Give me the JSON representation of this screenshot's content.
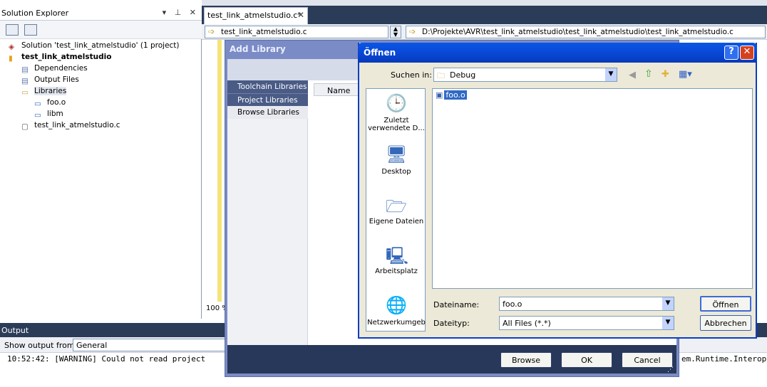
{
  "solution_explorer": {
    "title": "Solution Explorer",
    "controls": "▾ ⊥ ✕",
    "tree": [
      {
        "label": "Solution 'test_link_atmelstudio' (1 project)",
        "level": 0,
        "bold": false,
        "icon": "solution-icon"
      },
      {
        "label": "test_link_atmelstudio",
        "level": 0,
        "bold": true,
        "icon": "project-icon"
      },
      {
        "label": "Dependencies",
        "level": 1,
        "bold": false,
        "icon": "folder-icon"
      },
      {
        "label": "Output Files",
        "level": 1,
        "bold": false,
        "icon": "folder-icon"
      },
      {
        "label": "Libraries",
        "level": 1,
        "bold": false,
        "icon": "folder-open-icon"
      },
      {
        "label": "foo.o",
        "level": 2,
        "bold": false,
        "icon": "reference-icon"
      },
      {
        "label": "libm",
        "level": 2,
        "bold": false,
        "icon": "reference-icon"
      },
      {
        "label": "test_link_atmelstudio.c",
        "level": 1,
        "bold": false,
        "icon": "c-file-icon"
      }
    ]
  },
  "editor": {
    "tab_label": "test_link_atmelstudio.c*",
    "tab_close": "✕",
    "nav_file": "test_link_atmelstudio.c",
    "nav_path": "D:\\Projekte\\AVR\\test_link_atmelstudio\\test_link_atmelstudio\\test_link_atmelstudio.c",
    "zoom": "100 %"
  },
  "output": {
    "title": "Output",
    "show_from_label": "Show output from:",
    "show_from_value": "General",
    "line": "10:52:42: [WARNING] Could not read project",
    "line_tail": "em.Runtime.Interop"
  },
  "add_library": {
    "title": "Add Library",
    "sidebar": [
      "Toolchain Libraries",
      "Project Libraries",
      "Browse Libraries"
    ],
    "column_name": "Name",
    "buttons": {
      "browse": "Browse",
      "ok": "OK",
      "cancel": "Cancel"
    }
  },
  "open_dialog": {
    "title": "Öffnen",
    "look_in_label": "Suchen in:",
    "look_in_value": "Debug",
    "places": [
      "Zuletzt verwendete D...",
      "Desktop",
      "Eigene Dateien",
      "Arbeitsplatz",
      "Netzwerkumgeb"
    ],
    "files": [
      "foo.o"
    ],
    "filename_label": "Dateiname:",
    "filename_value": "foo.o",
    "filetype_label": "Dateityp:",
    "filetype_value": "All Files (*.*)",
    "open_button": "Öffnen",
    "cancel_button": "Abbrechen",
    "help_button": "?",
    "close_button": "✕"
  },
  "colors": {
    "accent": "#0a56e4",
    "dark_header": "#2b3c59",
    "addlib_frame": "#7b8bc5"
  }
}
